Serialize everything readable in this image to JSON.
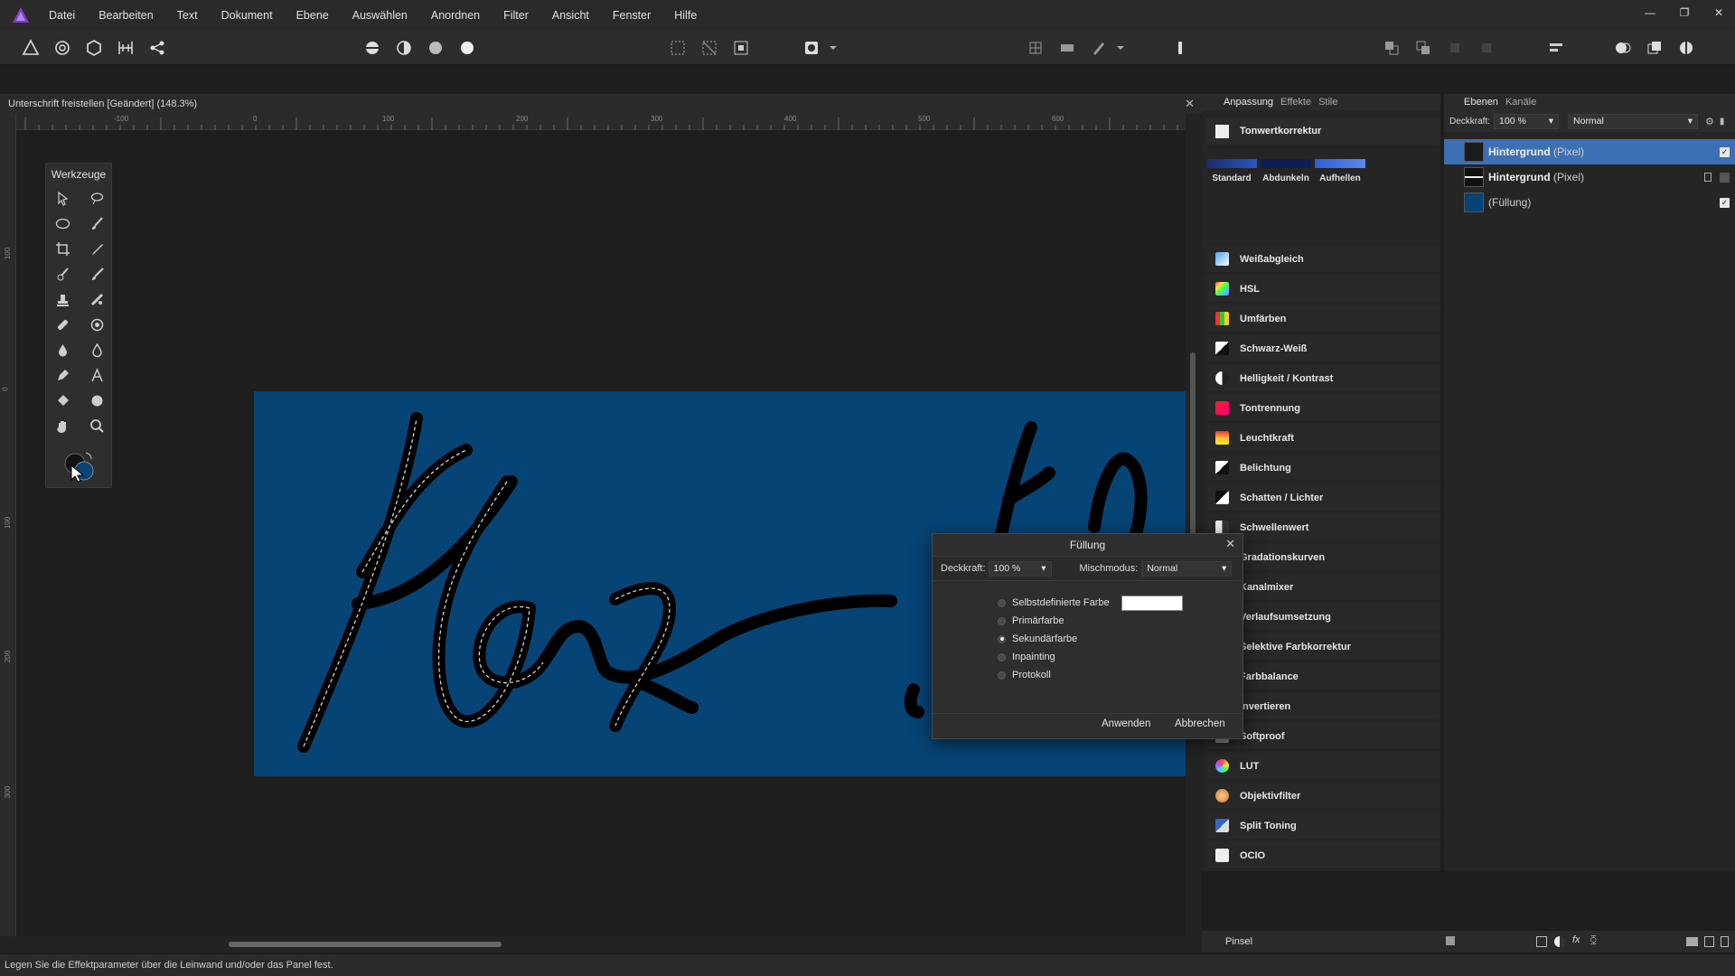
{
  "colors": {
    "accent": "#3d6fb3",
    "canvas_blue": "#064476",
    "app_purple": "#7b3fc4"
  },
  "menu": {
    "items": [
      "Datei",
      "Bearbeiten",
      "Text",
      "Dokument",
      "Ebene",
      "Auswählen",
      "Anordnen",
      "Filter",
      "Ansicht",
      "Fenster",
      "Hilfe"
    ]
  },
  "document": {
    "title": "Unterschrift freistellen [Geändert] (148.3%)"
  },
  "ruler": {
    "top_labels": [
      "-100",
      "0",
      "100",
      "200",
      "300",
      "400",
      "500",
      "600"
    ],
    "left_labels": [
      "100",
      "0",
      "100",
      "200",
      "300"
    ]
  },
  "tools_panel": {
    "title": "Werkzeuge",
    "tools": [
      "move-icon",
      "selection-brush-icon",
      "lasso-icon",
      "paint-brush-icon",
      "crop-icon",
      "eyedropper-icon",
      "dodge-brush-icon",
      "brush-icon",
      "clone-stamp-icon",
      "healing-icon",
      "inpainting-icon",
      "red-eye-icon",
      "fill-icon",
      "smudge-icon",
      "pen-icon",
      "text-icon",
      "flood-fill-icon",
      "shape-icon",
      "hand-icon",
      "zoom-icon"
    ]
  },
  "adjustments_panel": {
    "tabs": [
      "Anpassung",
      "Effekte",
      "Stile"
    ],
    "header": "Tonwertkorrektur",
    "presets": [
      "Standard",
      "Abdunkeln",
      "Aufhellen"
    ],
    "items": [
      "Weißabgleich",
      "HSL",
      "Umfärben",
      "Schwarz-Weiß",
      "Helligkeit / Kontrast",
      "Tontrennung",
      "Leuchtkraft",
      "Belichtung",
      "Schatten / Lichter",
      "Schwellenwert",
      "Gradationskurven",
      "Kanalmixer",
      "Verlaufsumsetzung",
      "Selektive Farbkorrektur",
      "Farbbalance",
      "Invertieren",
      "Softproof",
      "LUT",
      "Objektivfilter",
      "Split Toning",
      "OCIO"
    ]
  },
  "layers_panel": {
    "tabs": [
      "Ebenen",
      "Kanäle"
    ],
    "opacity_label": "Deckkraft:",
    "opacity_value": "100 %",
    "blend_mode": "Normal",
    "layers": [
      {
        "name": "Hintergrund",
        "type": "(Pixel)",
        "selected": true,
        "visible": true,
        "locked": false
      },
      {
        "name": "Hintergrund",
        "type": "(Pixel)",
        "selected": false,
        "visible": false,
        "locked": true
      },
      {
        "name": "",
        "type": "(Füllung)",
        "selected": false,
        "visible": true,
        "locked": false
      }
    ]
  },
  "brush_panel": {
    "label": "Pinsel"
  },
  "status": {
    "text": "Legen Sie die Effektparameter über die Leinwand und/oder das Panel fest."
  },
  "fill_dialog": {
    "title": "Füllung",
    "opacity_label": "Deckkraft:",
    "opacity_value": "100 %",
    "blend_label": "Mischmodus:",
    "blend_value": "Normal",
    "options": [
      {
        "label": "Selbstdefinierte Farbe",
        "selected": false
      },
      {
        "label": "Primärfarbe",
        "selected": false
      },
      {
        "label": "Sekundärfarbe",
        "selected": true
      },
      {
        "label": "Inpainting",
        "selected": false
      },
      {
        "label": "Protokoll",
        "selected": false
      }
    ],
    "custom_color": "#ffffff",
    "apply_label": "Anwenden",
    "cancel_label": "Abbrechen"
  }
}
